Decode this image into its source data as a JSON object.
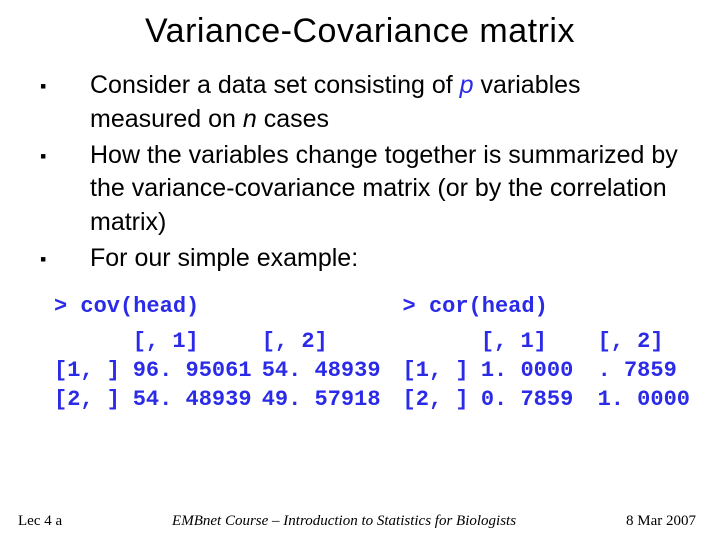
{
  "title": "Variance-Covariance matrix",
  "bullets": [
    {
      "pre": "Consider a data set consisting of ",
      "em1": "p",
      "mid": " variables measured on ",
      "em2": "n",
      "post": " cases"
    },
    {
      "text": "How the variables change together is summarized by the variance-covariance matrix (or by the correlation matrix)"
    },
    {
      "text": "For our simple example:"
    }
  ],
  "cov": {
    "cmd": "> cov(head)",
    "header": [
      "",
      "[, 1]",
      "[, 2]"
    ],
    "rows": [
      [
        "[1, ]",
        "96. 95061",
        "54. 48939"
      ],
      [
        "[2, ]",
        "54. 48939",
        "49. 57918"
      ]
    ]
  },
  "cor": {
    "cmd": "> cor(head)",
    "header": [
      "",
      "[, 1]",
      "[, 2]"
    ],
    "rows": [
      [
        "[1, ]",
        "1. 0000",
        ". 7859"
      ],
      [
        "[2, ]",
        "0. 7859",
        "1. 0000"
      ]
    ]
  },
  "footer": {
    "left": "Lec 4 a",
    "center": "EMBnet Course – Introduction to Statistics for Biologists",
    "right": "8 Mar 2007"
  },
  "chart_data": {
    "type": "table",
    "tables": [
      {
        "name": "cov(head)",
        "columns": [
          "[,1]",
          "[,2]"
        ],
        "rows": [
          {
            "label": "[1,]",
            "values": [
              96.95061,
              54.48939
            ]
          },
          {
            "label": "[2,]",
            "values": [
              54.48939,
              49.57918
            ]
          }
        ]
      },
      {
        "name": "cor(head)",
        "columns": [
          "[,1]",
          "[,2]"
        ],
        "rows": [
          {
            "label": "[1,]",
            "values": [
              1.0,
              0.7859
            ]
          },
          {
            "label": "[2,]",
            "values": [
              0.7859,
              1.0
            ]
          }
        ]
      }
    ]
  }
}
